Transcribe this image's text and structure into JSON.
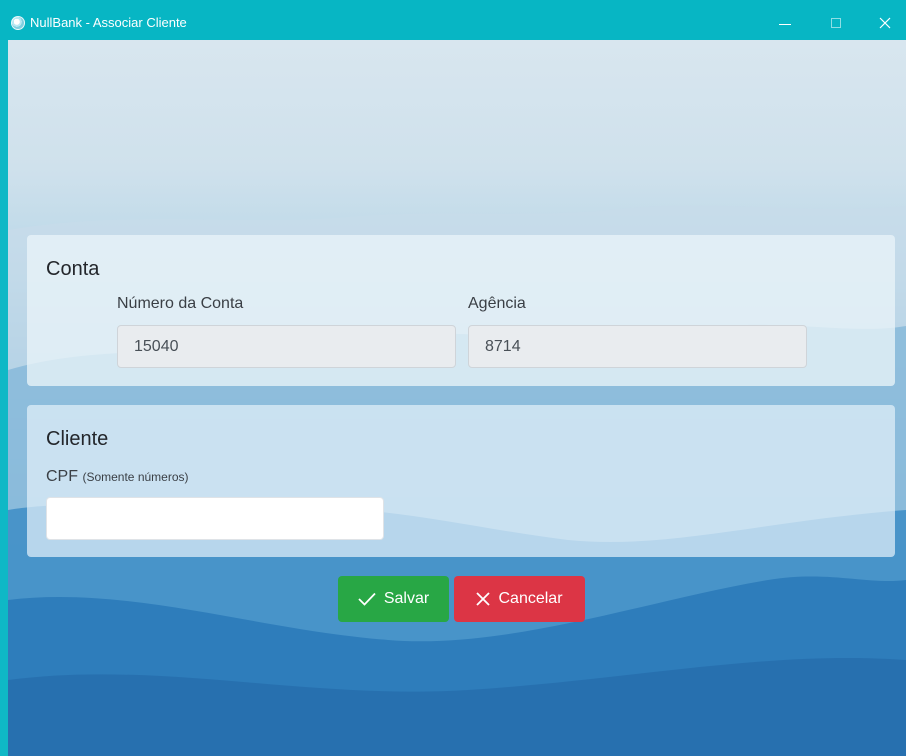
{
  "window": {
    "title": "NullBank - Associar Cliente",
    "app_icon": "nullbank-logo-icon",
    "controls": [
      "minimize-icon",
      "maximize-icon",
      "close-icon"
    ]
  },
  "conta": {
    "title": "Conta",
    "numero_label": "Número da Conta",
    "numero_value": "15040",
    "agencia_label": "Agência",
    "agencia_value": "8714"
  },
  "cliente": {
    "title": "Cliente",
    "cpf_label": "CPF",
    "cpf_hint": "(Somente números)",
    "cpf_value": "",
    "cpf_placeholder": ""
  },
  "actions": {
    "salvar_label": "Salvar",
    "salvar_icon": "check-icon",
    "cancelar_label": "Cancelar",
    "cancelar_icon": "x-icon"
  },
  "colors": {
    "titlebar": "#07b6c4",
    "salvar": "#28a745",
    "cancelar": "#dc3545"
  }
}
